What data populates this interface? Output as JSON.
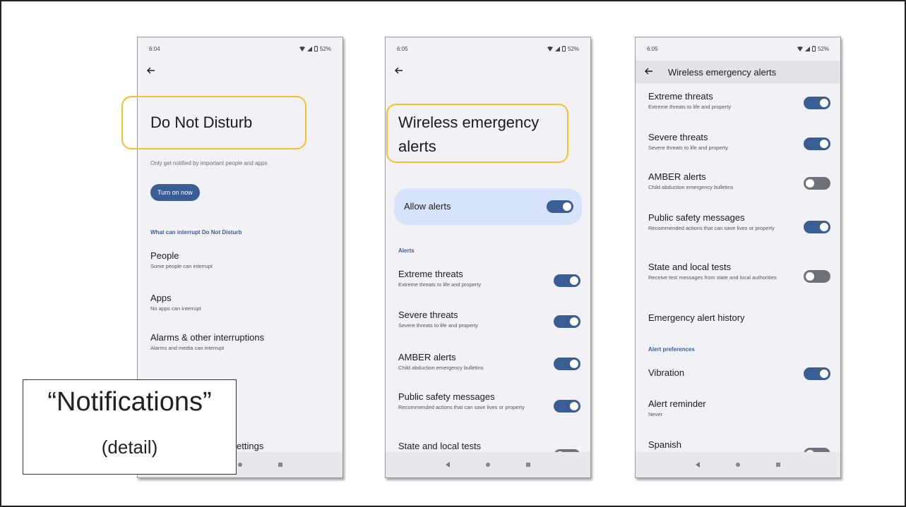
{
  "phone1": {
    "time": "6:04",
    "battery": "52%",
    "title": "Do Not Disturb",
    "subtitle": "Only get notified by important people and apps",
    "turn_on_label": "Turn on now",
    "section": "What can interrupt Do Not Disturb",
    "rows": [
      {
        "title": "People",
        "sub": "Some people can interrupt"
      },
      {
        "title": "Apps",
        "sub": "No apps can interrupt"
      },
      {
        "title": "Alarms & other interruptions",
        "sub": "Alarms and media can interrupt"
      }
    ],
    "partial_bottom": "ettings"
  },
  "phone2": {
    "time": "6:05",
    "battery": "52%",
    "title_line1": "Wireless emergency",
    "title_line2": "alerts",
    "allow_label": "Allow alerts",
    "allow_on": true,
    "section": "Alerts",
    "rows": [
      {
        "title": "Extreme threats",
        "sub": "Extreme threats to life and property",
        "on": true
      },
      {
        "title": "Severe threats",
        "sub": "Severe threats to life and property",
        "on": true
      },
      {
        "title": "AMBER alerts",
        "sub": "Child abduction emergency bulletins",
        "on": true
      },
      {
        "title": "Public safety messages",
        "sub": "Recommended actions that can save lives or property",
        "on": true
      },
      {
        "title": "State and local tests",
        "sub": "",
        "on": false
      }
    ]
  },
  "phone3": {
    "time": "6:05",
    "battery": "52%",
    "appbar_title": "Wireless emergency alerts",
    "rows": [
      {
        "title": "Extreme threats",
        "sub": "Extreme threats to life and property",
        "on": true
      },
      {
        "title": "Severe threats",
        "sub": "Severe threats to life and property",
        "on": true
      },
      {
        "title": "AMBER alerts",
        "sub": "Child abduction emergency bulletins",
        "on": false
      },
      {
        "title": "Public safety messages",
        "sub": "Recommended actions that can save lives or property",
        "on": true
      },
      {
        "title": "State and local tests",
        "sub": "Receive test messages from state and local authorities",
        "on": false
      },
      {
        "title": "Emergency alert history",
        "sub": ""
      }
    ],
    "section": "Alert preferences",
    "pref_rows": [
      {
        "title": "Vibration",
        "sub": "",
        "on": true
      },
      {
        "title": "Alert reminder",
        "sub": "Never"
      },
      {
        "title": "Spanish",
        "sub": "",
        "on": false
      }
    ]
  },
  "callout": {
    "main": "“Notifications”",
    "sub": "(detail)"
  },
  "colors": {
    "accent": "#3a5d94",
    "highlight": "#f2c12e",
    "toggle_off": "#6f7178",
    "card": "#d7e3fb"
  }
}
